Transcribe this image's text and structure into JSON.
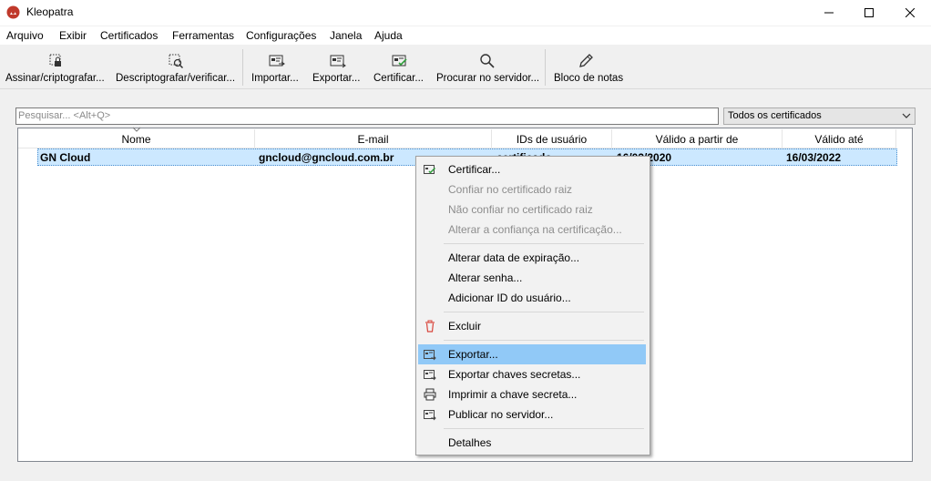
{
  "window": {
    "title": "Kleopatra",
    "minimize_glyph": "—",
    "maximize_glyph": "☐",
    "close_glyph": "✕"
  },
  "menu": [
    "Arquivo",
    "Exibir",
    "Certificados",
    "Ferramentas",
    "Configurações",
    "Janela",
    "Ajuda"
  ],
  "toolbar": [
    {
      "label": "Assinar/criptografar...",
      "icon": "sign-encrypt-icon"
    },
    {
      "label": "Descriptografar/verificar...",
      "icon": "decrypt-verify-icon"
    },
    {
      "label": "Importar...",
      "icon": "import-icon"
    },
    {
      "label": "Exportar...",
      "icon": "export-icon"
    },
    {
      "label": "Certificar...",
      "icon": "certify-icon"
    },
    {
      "label": "Procurar no servidor...",
      "icon": "search-icon"
    },
    {
      "label": "Bloco de notas",
      "icon": "pencil-icon"
    }
  ],
  "search": {
    "placeholder": "Pesquisar... <Alt+Q>"
  },
  "filter": {
    "selected": "Todos os certificados"
  },
  "table": {
    "columns": [
      "Nome",
      "E-mail",
      "IDs de usuário",
      "Válido a partir de",
      "Válido até"
    ],
    "rows": [
      {
        "name": "GN Cloud",
        "email": "gncloud@gncloud.com.br",
        "user_ids": "certificado",
        "valid_from": "16/03/2020",
        "valid_until": "16/03/2022"
      }
    ]
  },
  "context_menu": {
    "highlight_color": "#91c9f7",
    "items": [
      {
        "label": "Certificar...",
        "enabled": true,
        "icon": "certify-icon"
      },
      {
        "label": "Confiar no certificado raiz",
        "enabled": false
      },
      {
        "label": "Não confiar no certificado raiz",
        "enabled": false
      },
      {
        "label": "Alterar a confiança na certificação...",
        "enabled": false
      },
      {
        "label": "Alterar data de expiração...",
        "enabled": true
      },
      {
        "label": "Alterar senha...",
        "enabled": true
      },
      {
        "label": "Adicionar ID do usuário...",
        "enabled": true
      },
      {
        "label": "Excluir",
        "enabled": true,
        "icon": "trash-icon"
      },
      {
        "label": "Exportar...",
        "enabled": true,
        "icon": "export-icon",
        "highlighted": true
      },
      {
        "label": "Exportar chaves secretas...",
        "enabled": true,
        "icon": "export-secret-icon"
      },
      {
        "label": "Imprimir a chave secreta...",
        "enabled": true,
        "icon": "printer-icon"
      },
      {
        "label": "Publicar no servidor...",
        "enabled": true,
        "icon": "publish-icon"
      },
      {
        "label": "Detalhes",
        "enabled": true
      }
    ]
  }
}
